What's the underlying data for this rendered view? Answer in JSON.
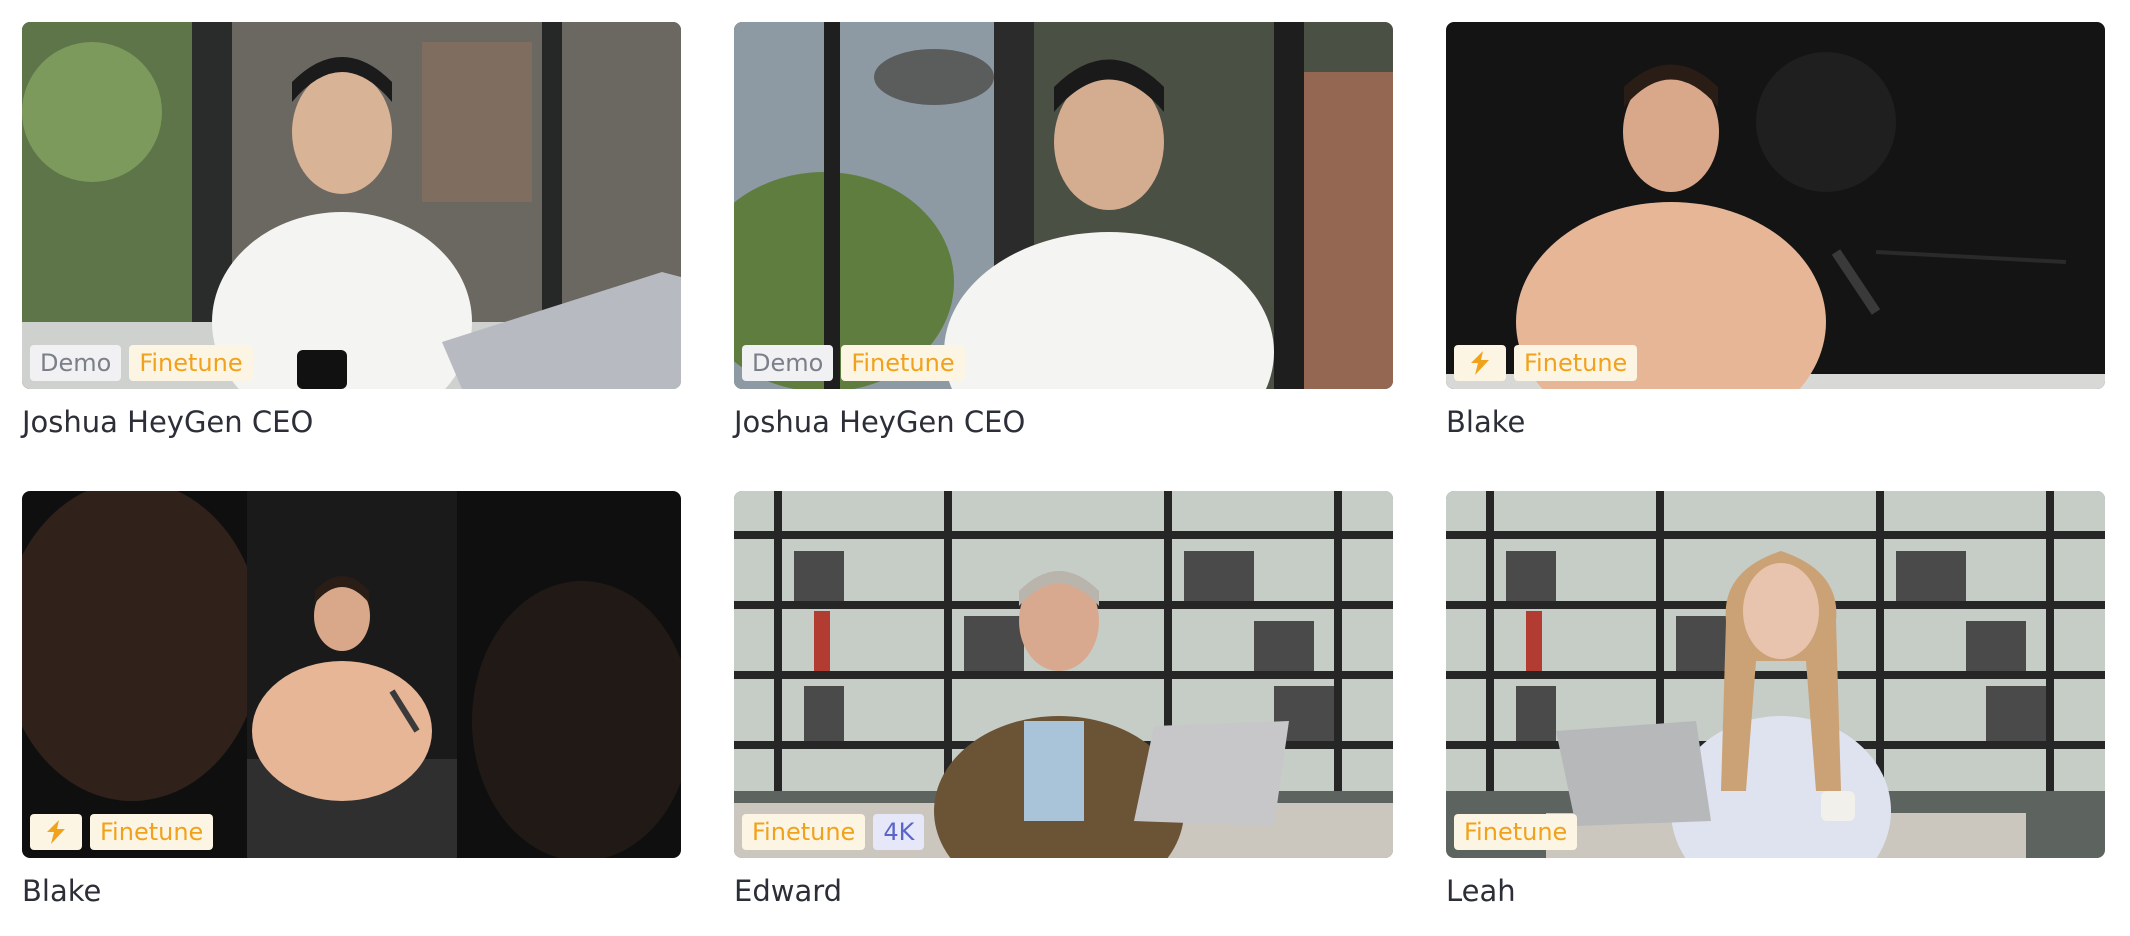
{
  "avatars": [
    {
      "name": "Joshua HeyGen CEO",
      "badges": [
        "Demo",
        "Finetune"
      ],
      "scene": "office-laptop",
      "thumb_colors": [
        "#3b3f3a",
        "#f4f4f2"
      ]
    },
    {
      "name": "Joshua HeyGen CEO",
      "badges": [
        "Demo",
        "Finetune"
      ],
      "scene": "office-window",
      "thumb_colors": [
        "#4b5044",
        "#f4f4f2"
      ]
    },
    {
      "name": "Blake",
      "badge_icon": "bolt-icon",
      "badges": [
        "Finetune"
      ],
      "scene": "dark-studio",
      "thumb_colors": [
        "#141414",
        "#e6b697"
      ]
    },
    {
      "name": "Blake",
      "badge_icon": "bolt-icon",
      "badges": [
        "Finetune"
      ],
      "scene": "dark-studio-portrait",
      "thumb_colors": [
        "#0f0f0f",
        "#e6b697"
      ]
    },
    {
      "name": "Edward",
      "badges": [
        "Finetune",
        "4K"
      ],
      "scene": "bookshelf-laptop",
      "thumb_colors": [
        "#5d635f",
        "#6b5336"
      ]
    },
    {
      "name": "Leah",
      "badges": [
        "Finetune"
      ],
      "scene": "bookshelf-laptop",
      "thumb_colors": [
        "#5d635f",
        "#dfe3f0"
      ]
    }
  ],
  "colors": {
    "badge_finetune_bg": "#fdf5e4",
    "badge_finetune_text": "#f0a21c",
    "badge_demo_bg": "#f1f1f3",
    "badge_demo_text": "#7b7f8a",
    "badge_4k_bg": "#e6e8f9",
    "badge_4k_text": "#5965c9"
  }
}
